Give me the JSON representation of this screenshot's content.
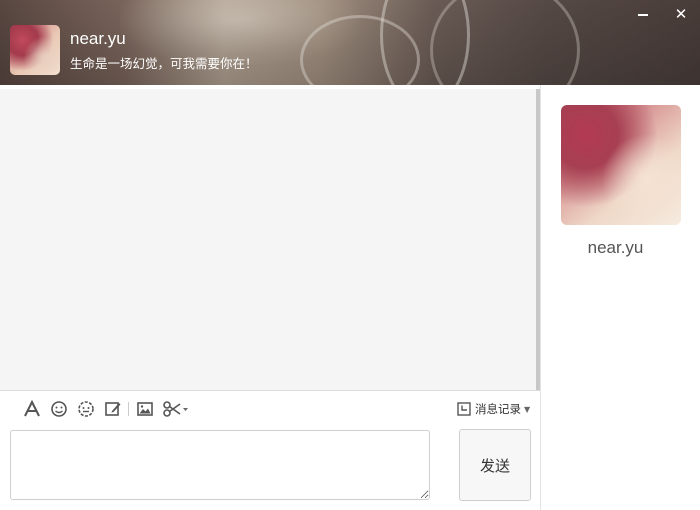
{
  "header": {
    "name": "near.yu",
    "signature": "生命是一场幻觉，可我需要你在！",
    "minimize_icon": "minimize-icon",
    "close_icon": "close-icon",
    "close_glyph": "✕"
  },
  "toolbar": {
    "tools": [
      "font-icon",
      "emoji-icon",
      "sticker-icon",
      "edit-icon",
      "image-icon",
      "scissors-icon"
    ],
    "history_label": "消息记录",
    "history_icon": "history-icon"
  },
  "input": {
    "value": "",
    "placeholder": ""
  },
  "send": {
    "label": "发送"
  },
  "contact": {
    "name": "near.yu"
  }
}
